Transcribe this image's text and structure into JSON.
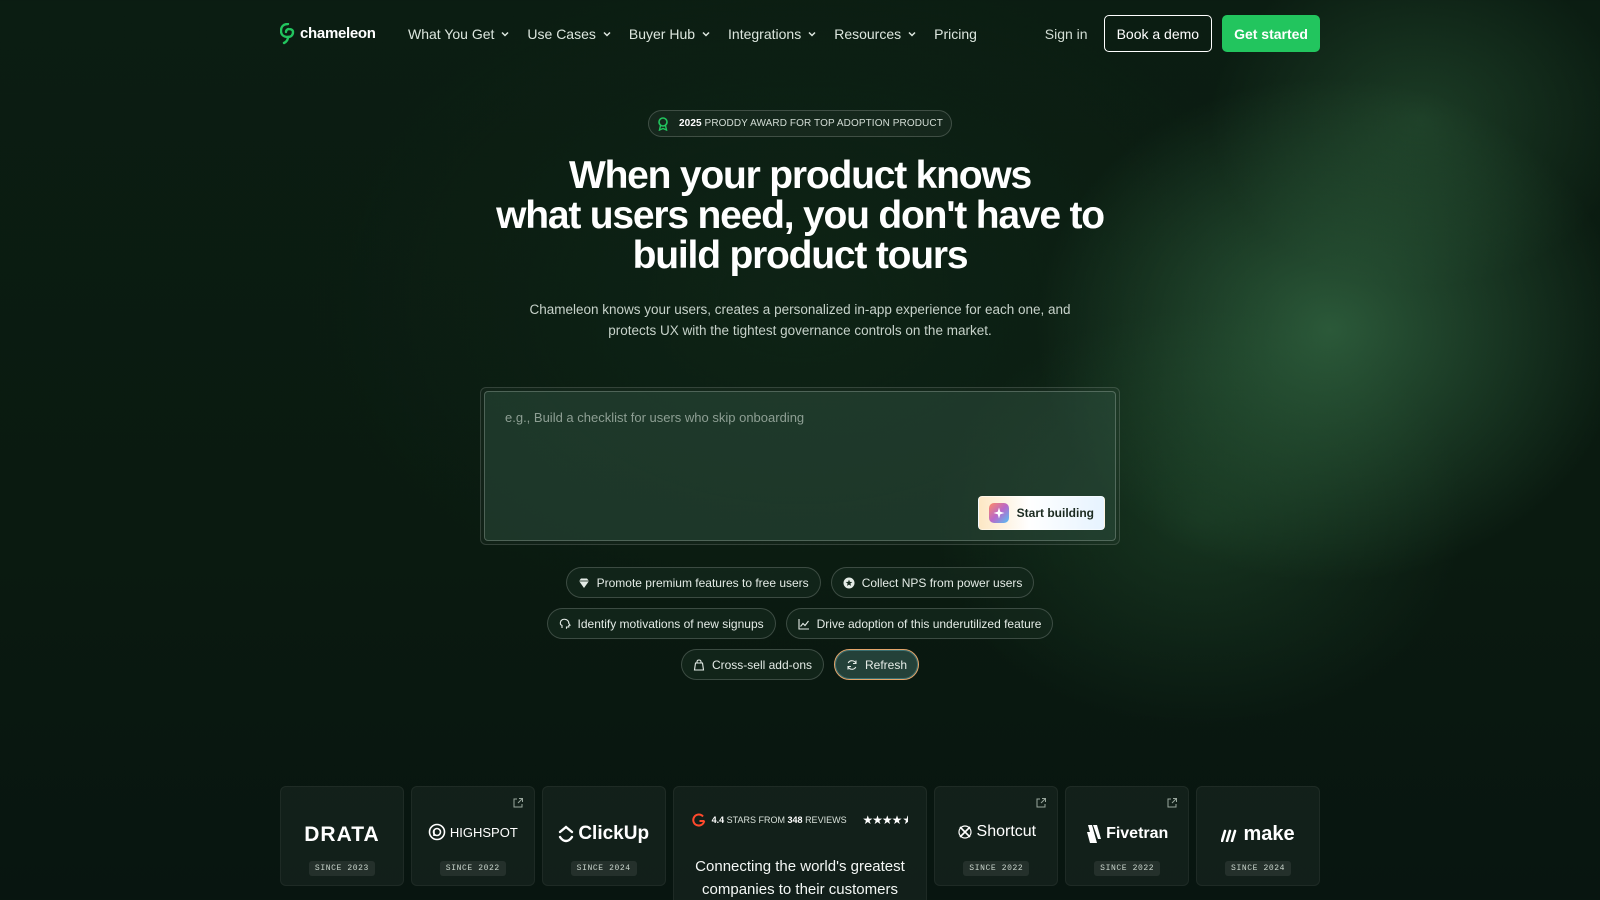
{
  "nav": {
    "brand": "chameleon",
    "links": [
      {
        "label": "What You Get",
        "dropdown": true
      },
      {
        "label": "Use Cases",
        "dropdown": true
      },
      {
        "label": "Buyer Hub",
        "dropdown": true
      },
      {
        "label": "Integrations",
        "dropdown": true
      },
      {
        "label": "Resources",
        "dropdown": true
      },
      {
        "label": "Pricing",
        "dropdown": false
      }
    ],
    "sign_in": "Sign in",
    "book_demo": "Book a demo",
    "get_started": "Get started"
  },
  "hero": {
    "award_year": "2025",
    "award_text": "Proddy Award for Top Adoption Product",
    "headline_line1": "When your product knows",
    "headline_line2": "what users need, you don't have to",
    "headline_line3": "build product tours",
    "subtext_line1": "Chameleon knows your users, creates a personalized in-app experience for each one, and",
    "subtext_line2": "protects UX with the tightest governance controls on the market."
  },
  "prompt": {
    "placeholder": "e.g., Build a checklist for users who skip onboarding",
    "value": "",
    "button": "Start building"
  },
  "chips": {
    "row1": [
      {
        "label": "Promote premium features to free users",
        "icon": "gem-icon"
      },
      {
        "label": "Collect NPS from power users",
        "icon": "star-circle-icon"
      }
    ],
    "row2": [
      {
        "label": "Identify motivations of new signups",
        "icon": "brain-icon"
      },
      {
        "label": "Drive adoption of this underutilized feature",
        "icon": "line-chart-icon"
      }
    ],
    "row3": [
      {
        "label": "Cross-sell add-ons",
        "icon": "cart-icon"
      },
      {
        "label": "Refresh",
        "icon": "refresh-icon"
      }
    ]
  },
  "customers": {
    "logos": [
      {
        "name": "DRATA",
        "since": "SINCE 2023",
        "external": false
      },
      {
        "name": "HIGHSPOT",
        "since": "SINCE 2022",
        "external": true
      },
      {
        "name": "ClickUp",
        "since": "SINCE 2024",
        "external": false
      },
      {
        "name": "Shortcut",
        "since": "SINCE 2022",
        "external": true
      },
      {
        "name": "Fivetran",
        "since": "SINCE 2022",
        "external": true
      },
      {
        "name": "make",
        "since": "SINCE 2024",
        "external": false
      }
    ],
    "rating": {
      "stars_value": "4.4",
      "stars_label": "STARS FROM",
      "reviews_count": "348",
      "reviews_label": "REVIEWS",
      "rating_out_of_5": 4.4
    },
    "headline_line1": "Connecting the world's greatest",
    "headline_line2": "companies to their customers"
  },
  "colors": {
    "accent_green": "#22c55e",
    "background": "#0b1d12",
    "refresh_border": "#e2a46a"
  }
}
